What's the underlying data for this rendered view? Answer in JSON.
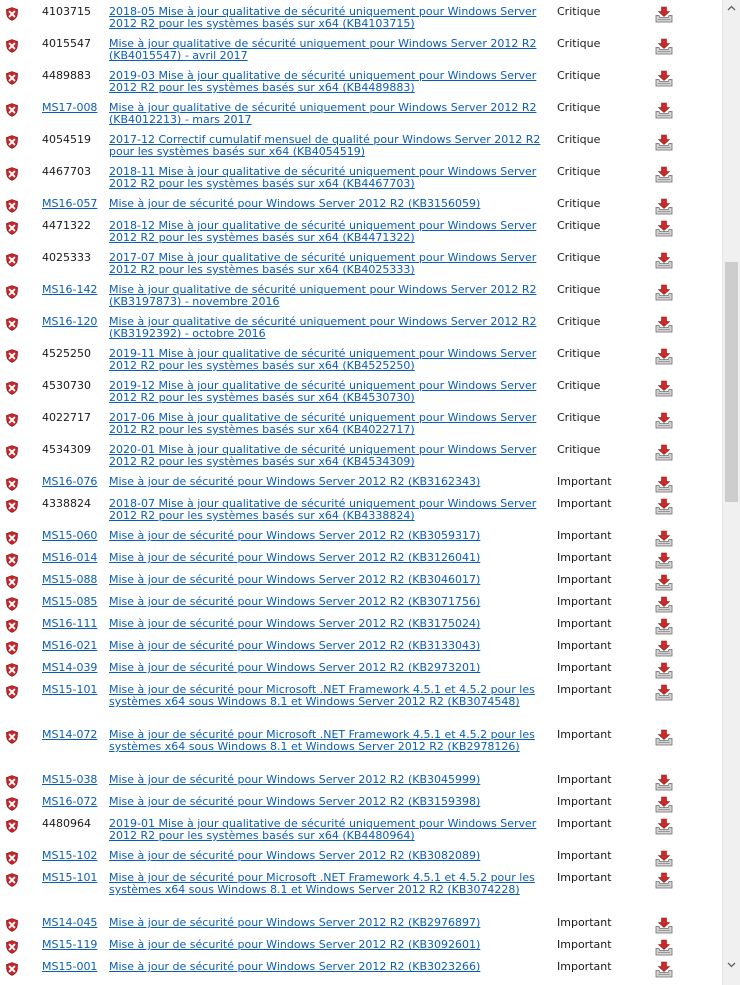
{
  "colors": {
    "link": "#0b5eb5",
    "shield": "#c8262b",
    "download_arrow": "#cc2a2a"
  },
  "icons": {
    "row_icon": "critical-shield-icon",
    "download": "download-icon"
  },
  "updates": [
    {
      "id": "4103715",
      "id_link": false,
      "title": "2018-05 Mise à jour qualitative de sécurité uniquement pour Windows Server 2012 R2 pour les systèmes basés sur x64 (KB4103715)",
      "severity": "Critique"
    },
    {
      "id": "4015547",
      "id_link": false,
      "title": "Mise à jour qualitative de sécurité uniquement pour Windows Server 2012 R2 (KB4015547) - avril 2017",
      "severity": "Critique"
    },
    {
      "id": "4489883",
      "id_link": false,
      "title": "2019-03 Mise à jour qualitative de sécurité uniquement pour Windows Server 2012 R2 pour les systèmes basés sur x64 (KB4489883)",
      "severity": "Critique"
    },
    {
      "id": "MS17-008",
      "id_link": true,
      "title": "Mise à jour qualitative de sécurité uniquement pour Windows Server 2012 R2 (KB4012213) - mars 2017",
      "severity": "Critique"
    },
    {
      "id": "4054519",
      "id_link": false,
      "title": "2017-12 Correctif cumulatif mensuel de qualité pour Windows Server 2012 R2 pour les systèmes basés sur x64 (KB4054519)",
      "severity": "Critique"
    },
    {
      "id": "4467703",
      "id_link": false,
      "title": "2018-11 Mise à jour qualitative de sécurité uniquement pour Windows Server 2012 R2 pour les systèmes basés sur x64 (KB4467703)",
      "severity": "Critique"
    },
    {
      "id": "MS16-057",
      "id_link": true,
      "title": "Mise à jour de sécurité pour Windows Server 2012 R2 (KB3156059)",
      "severity": "Critique"
    },
    {
      "id": "4471322",
      "id_link": false,
      "title": "2018-12 Mise à jour qualitative de sécurité uniquement pour Windows Server 2012 R2 pour les systèmes basés sur x64 (KB4471322)",
      "severity": "Critique"
    },
    {
      "id": "4025333",
      "id_link": false,
      "title": "2017-07 Mise à jour qualitative de sécurité uniquement pour Windows Server 2012 R2 pour les systèmes basés sur x64 (KB4025333)",
      "severity": "Critique"
    },
    {
      "id": "MS16-142",
      "id_link": true,
      "title": "Mise à jour qualitative de sécurité uniquement pour Windows Server 2012 R2 (KB3197873) - novembre 2016",
      "severity": "Critique"
    },
    {
      "id": "MS16-120",
      "id_link": true,
      "title": "Mise à jour qualitative de sécurité uniquement pour Windows Server 2012 R2 (KB3192392) - octobre 2016",
      "severity": "Critique"
    },
    {
      "id": "4525250",
      "id_link": false,
      "title": "2019-11 Mise à jour qualitative de sécurité uniquement pour Windows Server 2012 R2 pour les systèmes basés sur x64 (KB4525250)",
      "severity": "Critique"
    },
    {
      "id": "4530730",
      "id_link": false,
      "title": "2019-12 Mise à jour qualitative de sécurité uniquement pour Windows Server 2012 R2 pour les systèmes basés sur x64 (KB4530730)",
      "severity": "Critique"
    },
    {
      "id": "4022717",
      "id_link": false,
      "title": "2017-06 Mise à jour qualitative de sécurité uniquement pour Windows Server 2012 R2 pour les systèmes basés sur x64 (KB4022717)",
      "severity": "Critique"
    },
    {
      "id": "4534309",
      "id_link": false,
      "title": "2020-01 Mise à jour qualitative de sécurité uniquement pour Windows Server 2012 R2 pour les systèmes basés sur x64 (KB4534309)",
      "severity": "Critique"
    },
    {
      "id": "MS16-076",
      "id_link": true,
      "title": "Mise à jour de sécurité pour Windows Server 2012 R2 (KB3162343)",
      "severity": "Important"
    },
    {
      "id": "4338824",
      "id_link": false,
      "title": "2018-07 Mise à jour qualitative de sécurité uniquement pour Windows Server 2012 R2 pour les systèmes basés sur x64 (KB4338824)",
      "severity": "Important"
    },
    {
      "id": "MS15-060",
      "id_link": true,
      "title": "Mise à jour de sécurité pour Windows Server 2012 R2 (KB3059317)",
      "severity": "Important"
    },
    {
      "id": "MS16-014",
      "id_link": true,
      "title": "Mise à jour de sécurité pour Windows Server 2012 R2 (KB3126041)",
      "severity": "Important"
    },
    {
      "id": "MS15-088",
      "id_link": true,
      "title": "Mise à jour de sécurité pour Windows Server 2012 R2 (KB3046017)",
      "severity": "Important"
    },
    {
      "id": "MS15-085",
      "id_link": true,
      "title": "Mise à jour de sécurité pour Windows Server 2012 R2 (KB3071756)",
      "severity": "Important"
    },
    {
      "id": "MS16-111",
      "id_link": true,
      "title": "Mise à jour de sécurité pour Windows Server 2012 R2 (KB3175024)",
      "severity": "Important"
    },
    {
      "id": "MS16-021",
      "id_link": true,
      "title": "Mise à jour de sécurité pour Windows Server 2012 R2 (KB3133043)",
      "severity": "Important"
    },
    {
      "id": "MS14-039",
      "id_link": true,
      "title": "Mise à jour de sécurité pour Windows Server 2012 R2 (KB2973201)",
      "severity": "Important"
    },
    {
      "id": "MS15-101",
      "id_link": true,
      "title": "Mise à jour de sécurité pour Microsoft .NET Framework 4.5.1 et 4.5.2 pour les systèmes x64 sous Windows 8.1 et Windows Server 2012 R2 (KB3074548)",
      "severity": "Important"
    },
    {
      "id": "MS14-072",
      "id_link": true,
      "title": "Mise à jour de sécurité pour Microsoft .NET Framework 4.5.1 et 4.5.2 pour les systèmes x64 sous Windows 8.1 et Windows Server 2012 R2 (KB2978126)",
      "severity": "Important"
    },
    {
      "id": "MS15-038",
      "id_link": true,
      "title": "Mise à jour de sécurité pour Windows Server 2012 R2 (KB3045999)",
      "severity": "Important"
    },
    {
      "id": "MS16-072",
      "id_link": true,
      "title": "Mise à jour de sécurité pour Windows Server 2012 R2 (KB3159398)",
      "severity": "Important"
    },
    {
      "id": "4480964",
      "id_link": false,
      "title": "2019-01 Mise à jour qualitative de sécurité uniquement pour Windows Server 2012 R2 pour les systèmes basés sur x64 (KB4480964)",
      "severity": "Important"
    },
    {
      "id": "MS15-102",
      "id_link": true,
      "title": "Mise à jour de sécurité pour Windows Server 2012 R2 (KB3082089)",
      "severity": "Important"
    },
    {
      "id": "MS15-101",
      "id_link": true,
      "title": "Mise à jour de sécurité pour Microsoft .NET Framework 4.5.1 et 4.5.2 pour les systèmes x64 sous Windows 8.1 et Windows Server 2012 R2 (KB3074228)",
      "severity": "Important"
    },
    {
      "id": "MS14-045",
      "id_link": true,
      "title": "Mise à jour de sécurité pour Windows Server 2012 R2 (KB2976897)",
      "severity": "Important"
    },
    {
      "id": "MS15-119",
      "id_link": true,
      "title": "Mise à jour de sécurité pour Windows Server 2012 R2 (KB3092601)",
      "severity": "Important"
    },
    {
      "id": "MS15-001",
      "id_link": true,
      "title": "Mise à jour de sécurité pour Windows Server 2012 R2 (KB3023266)",
      "severity": "Important"
    }
  ]
}
